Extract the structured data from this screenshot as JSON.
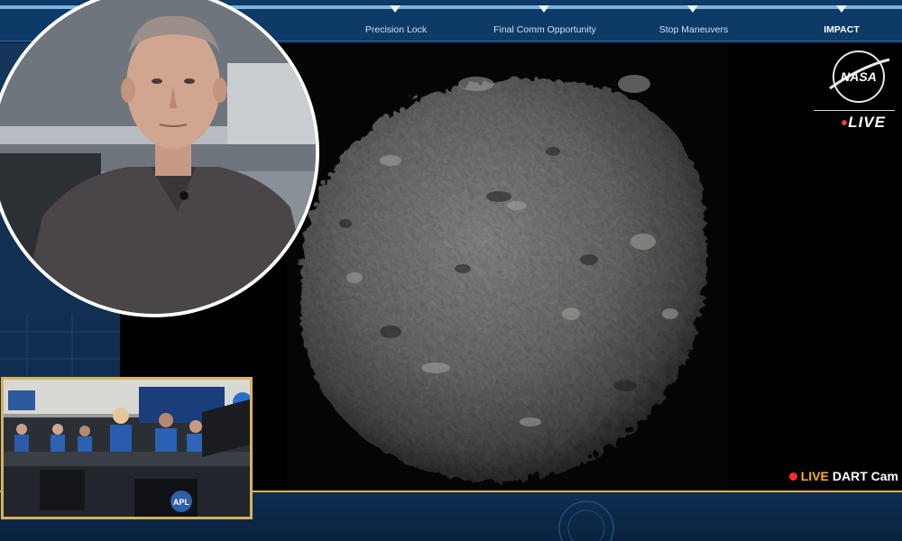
{
  "timeline": {
    "labels": {
      "precision_lock": "Precision Lock",
      "final_comm": "Final Comm Opportunity",
      "stop_maneuvers": "Stop Maneuvers",
      "impact": "IMPACT"
    }
  },
  "broadcast": {
    "nasa_logo_text": "NASA",
    "live_badge": "LIVE",
    "feed_label_live": "LIVE",
    "feed_label_cam": "DART Cam"
  },
  "control_room": {
    "logo_text": "APL"
  },
  "colors": {
    "accent_gold": "#d7b35a",
    "live_orange": "#ffb400",
    "rec_red": "#ff2a2a",
    "nasa_red": "#e03a2f"
  }
}
